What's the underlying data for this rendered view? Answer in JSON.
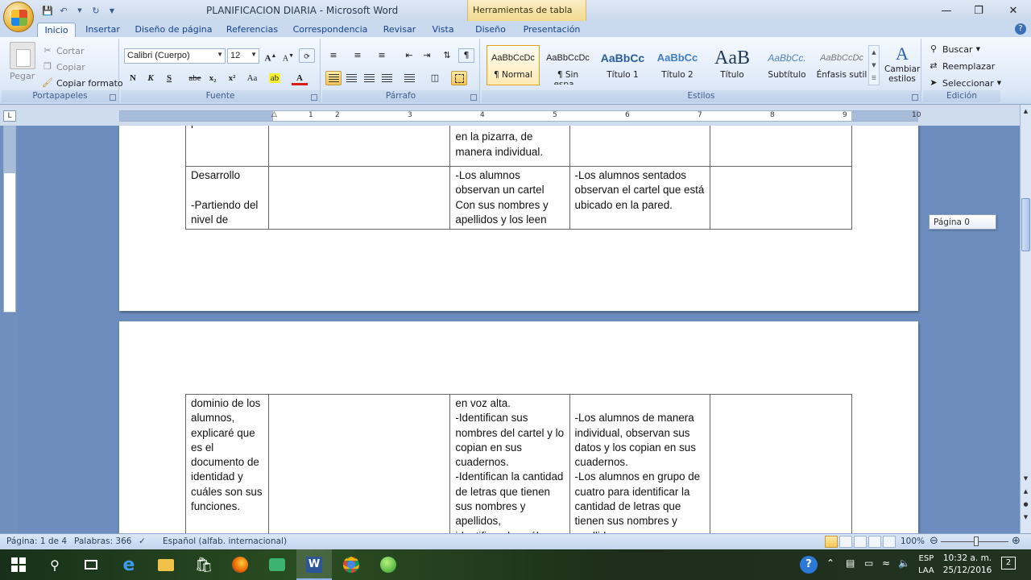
{
  "window": {
    "title": "PLANIFICACION DIARIA - Microsoft Word",
    "context_tab_header": "Herramientas de tabla"
  },
  "tabs": [
    {
      "label": "Inicio",
      "active": true
    },
    {
      "label": "Insertar"
    },
    {
      "label": "Diseño de página"
    },
    {
      "label": "Referencias"
    },
    {
      "label": "Correspondencia"
    },
    {
      "label": "Revisar"
    },
    {
      "label": "Vista"
    },
    {
      "label": "Diseño"
    },
    {
      "label": "Presentación"
    }
  ],
  "clipboard": {
    "paste": "Pegar",
    "cut": "Cortar",
    "copy": "Copiar",
    "format_painter": "Copiar formato",
    "label": "Portapapeles"
  },
  "font": {
    "family": "Calibri (Cuerpo)",
    "size": "12",
    "label": "Fuente",
    "bold": "N",
    "italic": "K",
    "underline": "S",
    "strike": "abe",
    "subscript": "x₂",
    "superscript": "x²",
    "case": "Aa"
  },
  "paragraph": {
    "label": "Párrafo"
  },
  "styles": {
    "label": "Estilos",
    "items": [
      {
        "preview": "AaBbCcDc",
        "name": "¶ Normal",
        "selected": true
      },
      {
        "preview": "AaBbCcDc",
        "name": "¶ Sin espa..."
      },
      {
        "preview": "AaBbCc",
        "name": "Título 1"
      },
      {
        "preview": "AaBbCc",
        "name": "Título 2"
      },
      {
        "preview": "AaB",
        "name": "Título"
      },
      {
        "preview": "AaBbCc.",
        "name": "Subtítulo"
      },
      {
        "preview": "AaBbCcDc",
        "name": "Énfasis sutil"
      }
    ],
    "change": "Cambiar estilos"
  },
  "editing": {
    "find": "Buscar",
    "replace": "Reemplazar",
    "select": "Seleccionar",
    "label": "Edición"
  },
  "ruler": {
    "numbers": [
      "1",
      "2",
      "3",
      "4",
      "5",
      "6",
      "7",
      "8",
      "9",
      "10"
    ]
  },
  "page1_table": {
    "rows": [
      [
        "previo.",
        "",
        "escriben sus nombres en la pizarra, de manera individual.",
        "",
        ""
      ],
      [
        "Desarrollo\n\n-Partiendo del nivel de",
        "",
        "-Los alumnos observan un cartel Con sus nombres y apellidos y los leen",
        "-Los alumnos sentados observan el cartel que está ubicado en la pared.",
        ""
      ]
    ]
  },
  "page2_table": {
    "rows": [
      [
        "dominio de los alumnos, explicaré que es el documento de identidad y cuáles son sus funciones.",
        "",
        "en voz alta.\n-Identifican sus nombres del cartel y lo copian en sus cuadernos.\n-Identifican la cantidad de letras que tienen sus nombres y apellidos, identificando cuáles",
        "\n-Los alumnos de manera individual, observan sus datos y los copian en sus cuadernos.\n-Los alumnos en grupo de cuatro para identificar la cantidad de letras que tienen sus nombres y apellidos",
        ""
      ]
    ]
  },
  "tooltip": "Página 0",
  "statusbar": {
    "page": "Página: 1 de 4",
    "words": "Palabras: 366",
    "language": "Español (alfab. internacional)",
    "zoom": "100%"
  },
  "taskbar": {
    "lang_line1": "ESP",
    "lang_line2": "LAA",
    "time": "10:32 a. m.",
    "date": "25/12/2016",
    "notif_count": "2"
  }
}
